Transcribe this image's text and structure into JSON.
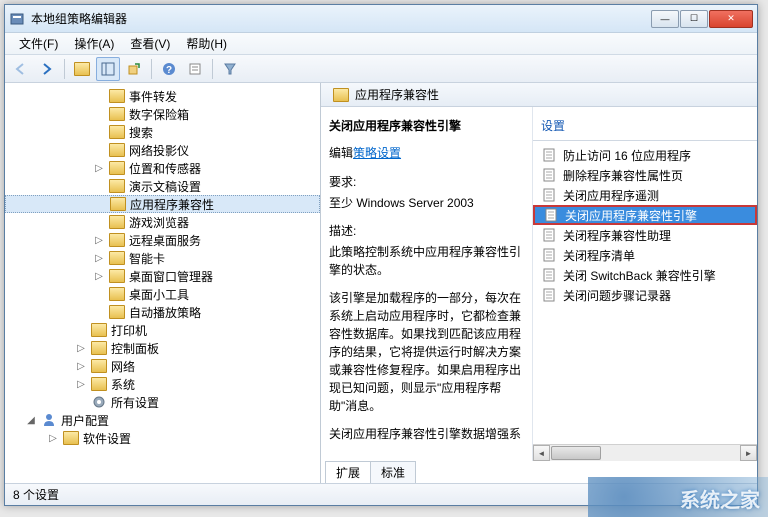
{
  "window": {
    "title": "本地组策略编辑器"
  },
  "menu": {
    "file": "文件(F)",
    "action": "操作(A)",
    "view": "查看(V)",
    "help": "帮助(H)"
  },
  "tree": {
    "items": [
      {
        "label": "事件转发",
        "indent": 88,
        "exp": ""
      },
      {
        "label": "数字保险箱",
        "indent": 88,
        "exp": ""
      },
      {
        "label": "搜索",
        "indent": 88,
        "exp": ""
      },
      {
        "label": "网络投影仪",
        "indent": 88,
        "exp": ""
      },
      {
        "label": "位置和传感器",
        "indent": 88,
        "exp": "▷"
      },
      {
        "label": "演示文稿设置",
        "indent": 88,
        "exp": ""
      },
      {
        "label": "应用程序兼容性",
        "indent": 88,
        "exp": "",
        "selected": true
      },
      {
        "label": "游戏浏览器",
        "indent": 88,
        "exp": ""
      },
      {
        "label": "远程桌面服务",
        "indent": 88,
        "exp": "▷"
      },
      {
        "label": "智能卡",
        "indent": 88,
        "exp": "▷"
      },
      {
        "label": "桌面窗口管理器",
        "indent": 88,
        "exp": "▷"
      },
      {
        "label": "桌面小工具",
        "indent": 88,
        "exp": ""
      },
      {
        "label": "自动播放策略",
        "indent": 88,
        "exp": ""
      },
      {
        "label": "打印机",
        "indent": 70,
        "exp": ""
      },
      {
        "label": "控制面板",
        "indent": 70,
        "exp": "▷"
      },
      {
        "label": "网络",
        "indent": 70,
        "exp": "▷"
      },
      {
        "label": "系统",
        "indent": 70,
        "exp": "▷"
      },
      {
        "label": "所有设置",
        "indent": 70,
        "exp": "",
        "icon": "gear"
      }
    ],
    "user_config": {
      "label": "用户配置",
      "indent": 20,
      "exp": "◢"
    },
    "software_settings": {
      "label": "软件设置",
      "indent": 42,
      "exp": "▷"
    }
  },
  "right": {
    "header": "应用程序兼容性",
    "detail": {
      "title": "关闭应用程序兼容性引擎",
      "edit_label": "编辑",
      "edit_link": "策略设置",
      "req_label": "要求:",
      "req_text": "至少 Windows Server 2003",
      "desc_label": "描述:",
      "desc_text1": "  此策略控制系统中应用程序兼容性引擎的状态。",
      "desc_text2": "  该引擎是加载程序的一部分，每次在系统上启动应用程序时，它都检查兼容性数据库。如果找到匹配该应用程序的结果，它将提供运行时解决方案或兼容性修复程序。如果启用程序出现已知问题，则显示\"应用程序帮助\"消息。",
      "desc_text3": "关闭应用程序兼容性引擎数据增强系"
    },
    "settings_header": "设置",
    "settings": [
      {
        "label": "防止访问 16 位应用程序"
      },
      {
        "label": "删除程序兼容性属性页"
      },
      {
        "label": "关闭应用程序遥测"
      },
      {
        "label": "关闭应用程序兼容性引擎",
        "selected": true
      },
      {
        "label": "关闭程序兼容性助理"
      },
      {
        "label": "关闭程序清单"
      },
      {
        "label": "关闭 SwitchBack 兼容性引擎"
      },
      {
        "label": "关闭问题步骤记录器"
      }
    ]
  },
  "tabs": {
    "extended": "扩展",
    "standard": "标准"
  },
  "status": "8 个设置",
  "watermark": "系统之家"
}
